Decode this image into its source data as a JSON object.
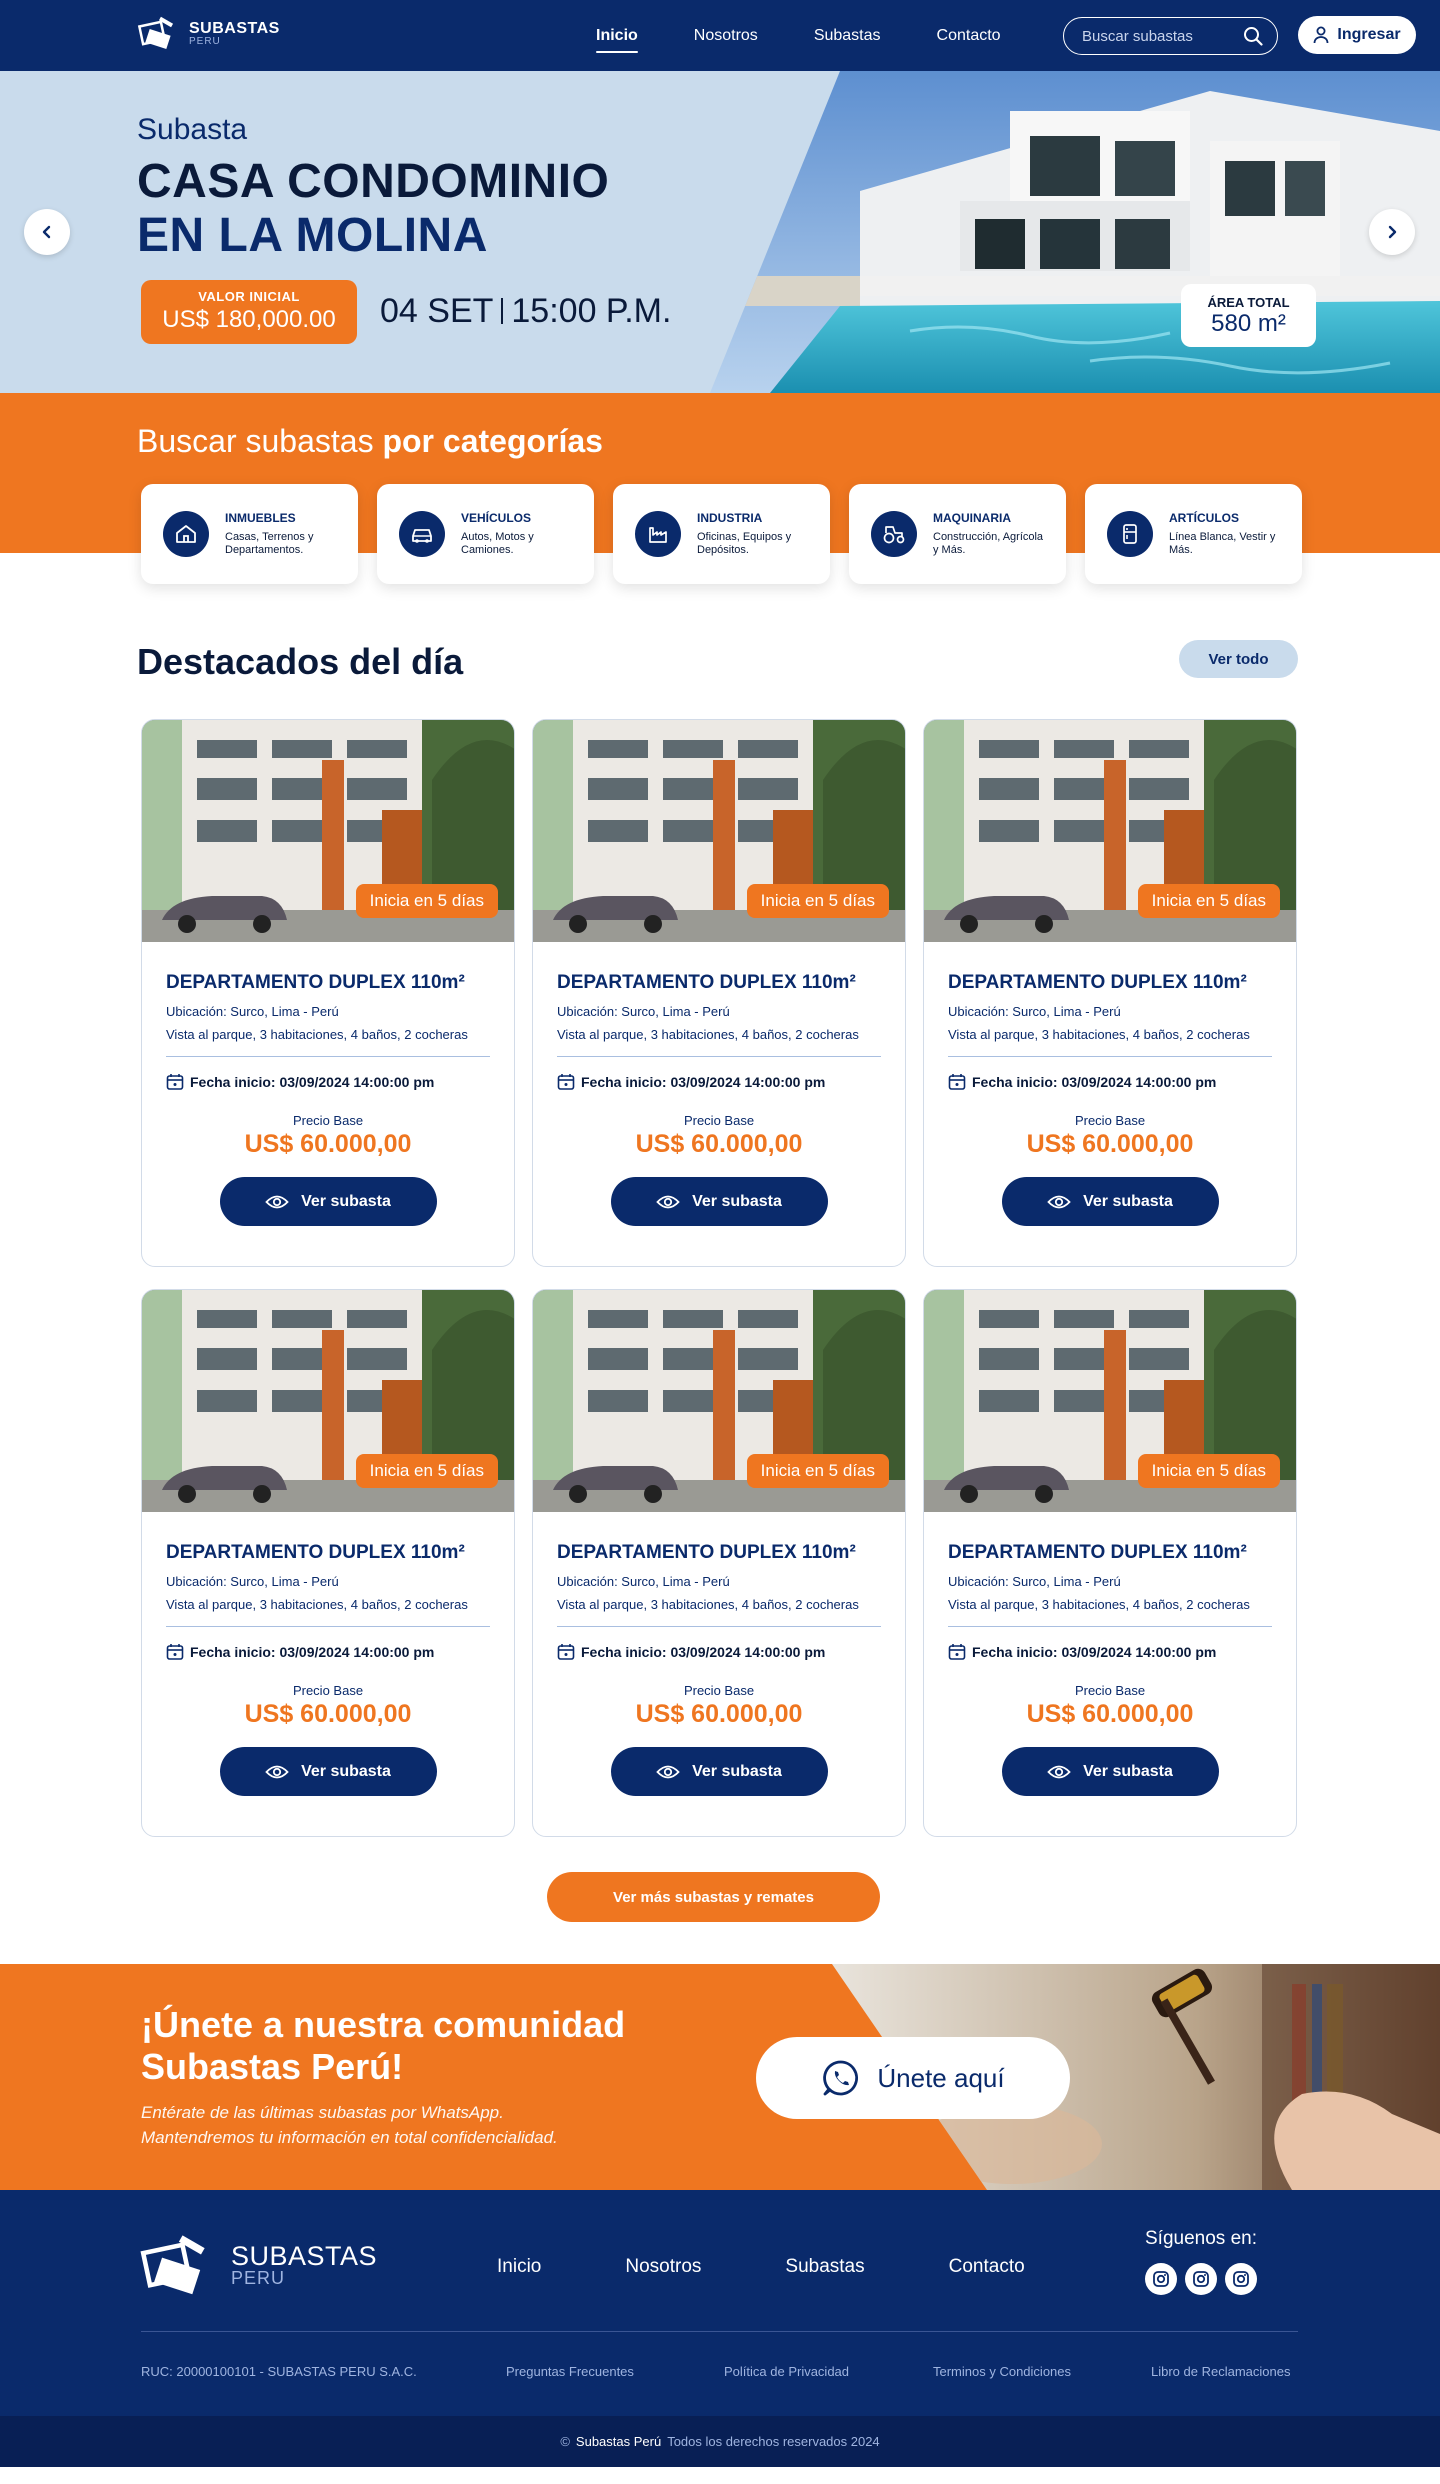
{
  "header": {
    "logo_line1": "SUBASTAS",
    "logo_line2": "PERU",
    "nav": [
      "Inicio",
      "Nosotros",
      "Subastas",
      "Contacto"
    ],
    "search_placeholder": "Buscar subastas",
    "login_label": "Ingresar"
  },
  "hero": {
    "subtitle": "Subasta",
    "title_line1": "CASA CONDOMINIO",
    "title_line2": "EN LA MOLINA",
    "price_label": "VALOR INICIAL",
    "price_value": "US$ 180,000.00",
    "date": "04 SET",
    "time": "15:00 P.M.",
    "area_label": "ÁREA TOTAL",
    "area_value": "580 m²"
  },
  "categories": {
    "heading_light": "Buscar subastas ",
    "heading_bold": "por categorías",
    "items": [
      {
        "name": "INMUEBLES",
        "desc": "Casas, Terrenos y Departamentos.",
        "icon": "house-icon"
      },
      {
        "name": "VEHÍCULOS",
        "desc": "Autos, Motos y Camiones.",
        "icon": "car-icon"
      },
      {
        "name": "INDUSTRIA",
        "desc": "Oficinas, Equipos y Depósitos.",
        "icon": "factory-icon"
      },
      {
        "name": "MAQUINARIA",
        "desc": "Construcción, Agrícola y Más.",
        "icon": "tractor-icon"
      },
      {
        "name": "ARTÍCULOS",
        "desc": "Línea Blanca, Vestir y Más.",
        "icon": "appliance-icon"
      }
    ]
  },
  "featured": {
    "title": "Destacados del día",
    "view_all": "Ver todo",
    "more_button": "Ver más subastas y remates",
    "cards": [
      {
        "badge": "Inicia en 5 días",
        "title": "DEPARTAMENTO DUPLEX 110m²",
        "location": "Ubicación: Surco, Lima - Perú",
        "desc": "Vista al parque, 3 habitaciones, 4 baños, 2 cocheras",
        "date": "Fecha inicio: 03/09/2024 14:00:00 pm",
        "price_label": "Precio Base",
        "price": "US$ 60.000,00",
        "button": "Ver subasta"
      },
      {
        "badge": "Inicia en 5 días",
        "title": "DEPARTAMENTO DUPLEX 110m²",
        "location": "Ubicación: Surco, Lima - Perú",
        "desc": "Vista al parque, 3 habitaciones, 4 baños, 2 cocheras",
        "date": "Fecha inicio: 03/09/2024 14:00:00 pm",
        "price_label": "Precio Base",
        "price": "US$ 60.000,00",
        "button": "Ver subasta"
      },
      {
        "badge": "Inicia en 5 días",
        "title": "DEPARTAMENTO DUPLEX 110m²",
        "location": "Ubicación: Surco, Lima - Perú",
        "desc": "Vista al parque, 3 habitaciones, 4 baños, 2 cocheras",
        "date": "Fecha inicio: 03/09/2024 14:00:00 pm",
        "price_label": "Precio Base",
        "price": "US$ 60.000,00",
        "button": "Ver subasta"
      },
      {
        "badge": "Inicia en 5 días",
        "title": "DEPARTAMENTO DUPLEX 110m²",
        "location": "Ubicación: Surco, Lima - Perú",
        "desc": "Vista al parque, 3 habitaciones, 4 baños, 2 cocheras",
        "date": "Fecha inicio: 03/09/2024 14:00:00 pm",
        "price_label": "Precio Base",
        "price": "US$ 60.000,00",
        "button": "Ver subasta"
      },
      {
        "badge": "Inicia en 5 días",
        "title": "DEPARTAMENTO DUPLEX 110m²",
        "location": "Ubicación: Surco, Lima - Perú",
        "desc": "Vista al parque, 3 habitaciones, 4 baños, 2 cocheras",
        "date": "Fecha inicio: 03/09/2024 14:00:00 pm",
        "price_label": "Precio Base",
        "price": "US$ 60.000,00",
        "button": "Ver subasta"
      },
      {
        "badge": "Inicia en 5 días",
        "title": "DEPARTAMENTO DUPLEX 110m²",
        "location": "Ubicación: Surco, Lima - Perú",
        "desc": "Vista al parque, 3 habitaciones, 4 baños, 2 cocheras",
        "date": "Fecha inicio: 03/09/2024 14:00:00 pm",
        "price_label": "Precio Base",
        "price": "US$ 60.000,00",
        "button": "Ver subasta"
      }
    ]
  },
  "community": {
    "title_line1": "¡Únete a nuestra comunidad",
    "title_line2": "Subastas Perú!",
    "text_line1": "Entérate de las últimas subastas por WhatsApp.",
    "text_line2": "Mantendremos tu información en total confidencialidad.",
    "button": "Únete aquí"
  },
  "footer": {
    "logo_line1": "SUBASTAS",
    "logo_line2": "PERU",
    "nav": [
      "Inicio",
      "Nosotros",
      "Subastas",
      "Contacto"
    ],
    "follow": "Síguenos en:",
    "ruc": "RUC: 20000100101 - SUBASTAS PERU S.A.C.",
    "faq": "Preguntas Frecuentes",
    "privacy": "Política de Privacidad",
    "terms": "Terminos y Condiciones",
    "complaints": "Libro de Reclamaciones",
    "copyright_symbol": "©",
    "copyright_brand": "Subastas Perú",
    "copyright_text": "Todos los derechos reservados 2024"
  },
  "colors": {
    "navy": "#0a2a6b",
    "orange": "#ef7620",
    "light_blue": "#c9dbec"
  }
}
